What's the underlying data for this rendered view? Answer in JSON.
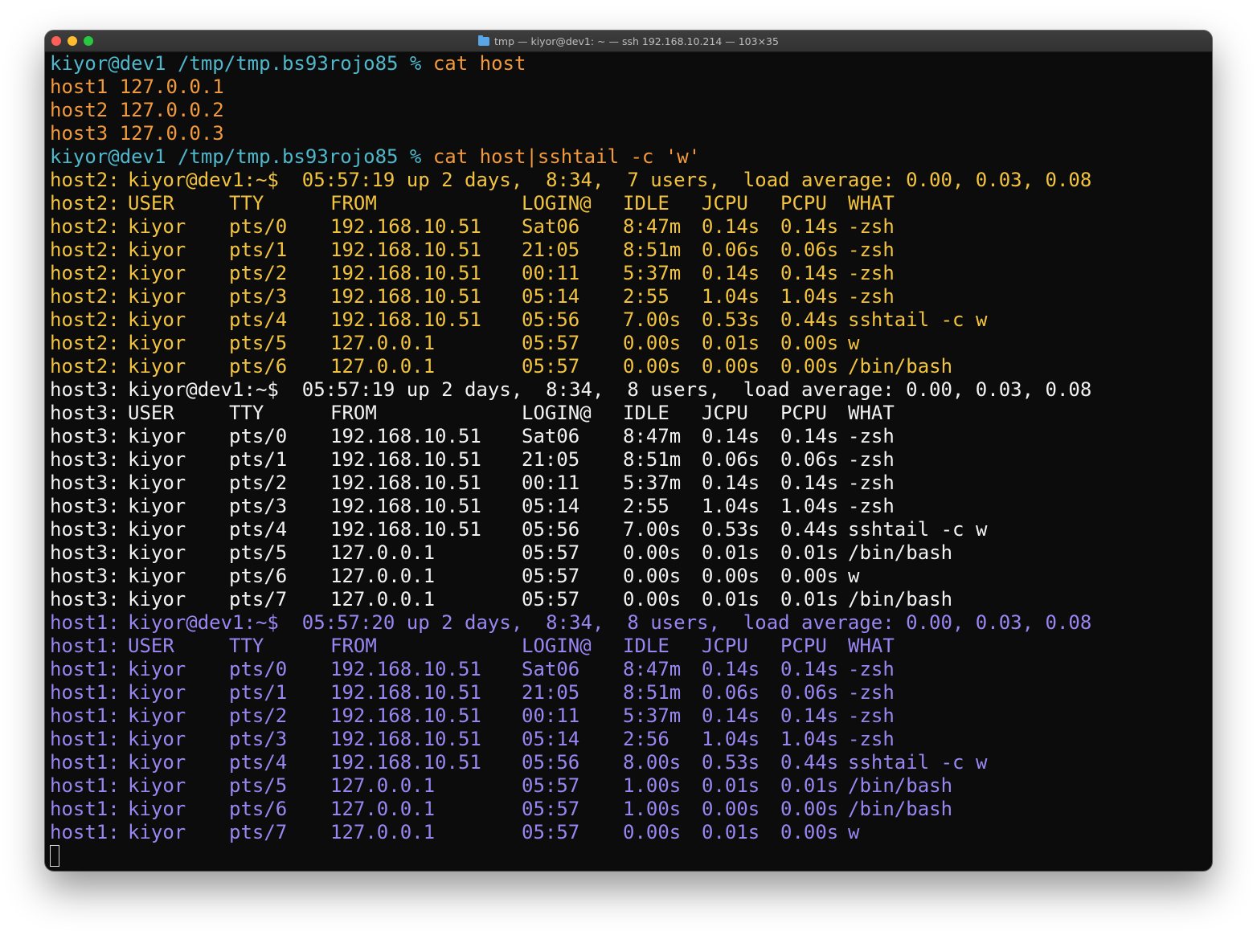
{
  "window": {
    "title": "tmp — kiyor@dev1: ~ — ssh 192.168.10.214 — 103×35",
    "icon": "folder-icon"
  },
  "colors": {
    "prompt": "#4fb8cc",
    "command": "#f29a3c",
    "host2": "#f2c33e",
    "host3": "#f2f2f2",
    "host1": "#9a86f2",
    "background": "#0c0c0c"
  },
  "terminal": {
    "commands": [
      {
        "prompt": "kiyor@dev1 /tmp/tmp.bs93rojo85 % ",
        "command": "cat host"
      },
      {
        "prompt": "kiyor@dev1 /tmp/tmp.bs93rojo85 % ",
        "command": "cat host|sshtail -c 'w'"
      }
    ],
    "cat_output": [
      "host1 127.0.0.1",
      "host2 127.0.0.2",
      "host3 127.0.0.3"
    ],
    "blocks": [
      {
        "host": "host2:",
        "uptime": "kiyor@dev1:~$  05:57:19 up 2 days,  8:34,  7 users,  load average: 0.00, 0.03, 0.08",
        "header": [
          "USER",
          "TTY",
          "FROM",
          "LOGIN@",
          "IDLE",
          "JCPU",
          "PCPU",
          "WHAT"
        ],
        "rows": [
          [
            "kiyor",
            "pts/0",
            "192.168.10.51",
            "Sat06",
            "8:47m",
            "0.14s",
            "0.14s",
            "-zsh"
          ],
          [
            "kiyor",
            "pts/1",
            "192.168.10.51",
            "21:05",
            "8:51m",
            "0.06s",
            "0.06s",
            "-zsh"
          ],
          [
            "kiyor",
            "pts/2",
            "192.168.10.51",
            "00:11",
            "5:37m",
            "0.14s",
            "0.14s",
            "-zsh"
          ],
          [
            "kiyor",
            "pts/3",
            "192.168.10.51",
            "05:14",
            "2:55",
            "1.04s",
            "1.04s",
            "-zsh"
          ],
          [
            "kiyor",
            "pts/4",
            "192.168.10.51",
            "05:56",
            "7.00s",
            "0.53s",
            "0.44s",
            "sshtail -c w"
          ],
          [
            "kiyor",
            "pts/5",
            "127.0.0.1",
            "05:57",
            "0.00s",
            "0.01s",
            "0.00s",
            "w"
          ],
          [
            "kiyor",
            "pts/6",
            "127.0.0.1",
            "05:57",
            "0.00s",
            "0.00s",
            "0.00s",
            "/bin/bash"
          ]
        ]
      },
      {
        "host": "host3:",
        "uptime": "kiyor@dev1:~$  05:57:19 up 2 days,  8:34,  8 users,  load average: 0.00, 0.03, 0.08",
        "header": [
          "USER",
          "TTY",
          "FROM",
          "LOGIN@",
          "IDLE",
          "JCPU",
          "PCPU",
          "WHAT"
        ],
        "rows": [
          [
            "kiyor",
            "pts/0",
            "192.168.10.51",
            "Sat06",
            "8:47m",
            "0.14s",
            "0.14s",
            "-zsh"
          ],
          [
            "kiyor",
            "pts/1",
            "192.168.10.51",
            "21:05",
            "8:51m",
            "0.06s",
            "0.06s",
            "-zsh"
          ],
          [
            "kiyor",
            "pts/2",
            "192.168.10.51",
            "00:11",
            "5:37m",
            "0.14s",
            "0.14s",
            "-zsh"
          ],
          [
            "kiyor",
            "pts/3",
            "192.168.10.51",
            "05:14",
            "2:55",
            "1.04s",
            "1.04s",
            "-zsh"
          ],
          [
            "kiyor",
            "pts/4",
            "192.168.10.51",
            "05:56",
            "7.00s",
            "0.53s",
            "0.44s",
            "sshtail -c w"
          ],
          [
            "kiyor",
            "pts/5",
            "127.0.0.1",
            "05:57",
            "0.00s",
            "0.01s",
            "0.01s",
            "/bin/bash"
          ],
          [
            "kiyor",
            "pts/6",
            "127.0.0.1",
            "05:57",
            "0.00s",
            "0.00s",
            "0.00s",
            "w"
          ],
          [
            "kiyor",
            "pts/7",
            "127.0.0.1",
            "05:57",
            "0.00s",
            "0.01s",
            "0.01s",
            "/bin/bash"
          ]
        ]
      },
      {
        "host": "host1:",
        "uptime": "kiyor@dev1:~$  05:57:20 up 2 days,  8:34,  8 users,  load average: 0.00, 0.03, 0.08",
        "header": [
          "USER",
          "TTY",
          "FROM",
          "LOGIN@",
          "IDLE",
          "JCPU",
          "PCPU",
          "WHAT"
        ],
        "rows": [
          [
            "kiyor",
            "pts/0",
            "192.168.10.51",
            "Sat06",
            "8:47m",
            "0.14s",
            "0.14s",
            "-zsh"
          ],
          [
            "kiyor",
            "pts/1",
            "192.168.10.51",
            "21:05",
            "8:51m",
            "0.06s",
            "0.06s",
            "-zsh"
          ],
          [
            "kiyor",
            "pts/2",
            "192.168.10.51",
            "00:11",
            "5:37m",
            "0.14s",
            "0.14s",
            "-zsh"
          ],
          [
            "kiyor",
            "pts/3",
            "192.168.10.51",
            "05:14",
            "2:56",
            "1.04s",
            "1.04s",
            "-zsh"
          ],
          [
            "kiyor",
            "pts/4",
            "192.168.10.51",
            "05:56",
            "8.00s",
            "0.53s",
            "0.44s",
            "sshtail -c w"
          ],
          [
            "kiyor",
            "pts/5",
            "127.0.0.1",
            "05:57",
            "1.00s",
            "0.01s",
            "0.01s",
            "/bin/bash"
          ],
          [
            "kiyor",
            "pts/6",
            "127.0.0.1",
            "05:57",
            "1.00s",
            "0.00s",
            "0.00s",
            "/bin/bash"
          ],
          [
            "kiyor",
            "pts/7",
            "127.0.0.1",
            "05:57",
            "0.00s",
            "0.01s",
            "0.00s",
            "w"
          ]
        ]
      }
    ]
  }
}
